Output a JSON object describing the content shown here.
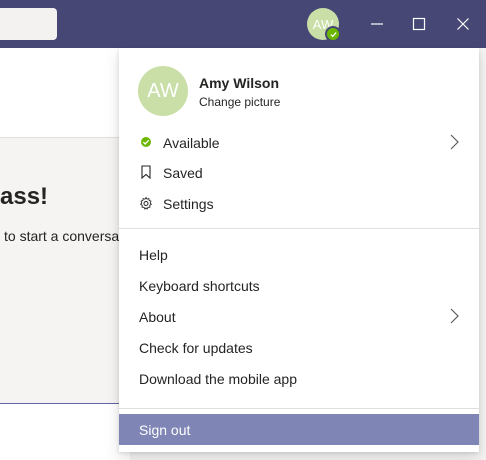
{
  "titlebar": {
    "avatar_initials": "AW",
    "status_color": "#6bb700",
    "bar_color": "#464775",
    "icons": [
      "minimize-icon",
      "maximize-icon",
      "close-icon"
    ]
  },
  "background": {
    "heading": "ass!",
    "subtext": "to start a conversat"
  },
  "menu": {
    "profile": {
      "initials": "AW",
      "name": "Amy Wilson",
      "change_picture": "Change picture"
    },
    "status": {
      "label": "Available",
      "color": "#6bb700"
    },
    "saved": "Saved",
    "settings": "Settings",
    "help": "Help",
    "keyboard_shortcuts": "Keyboard shortcuts",
    "about": "About",
    "check_updates": "Check for updates",
    "download_mobile": "Download the mobile app",
    "sign_out": "Sign out",
    "accent_color": "#7f85b5"
  }
}
